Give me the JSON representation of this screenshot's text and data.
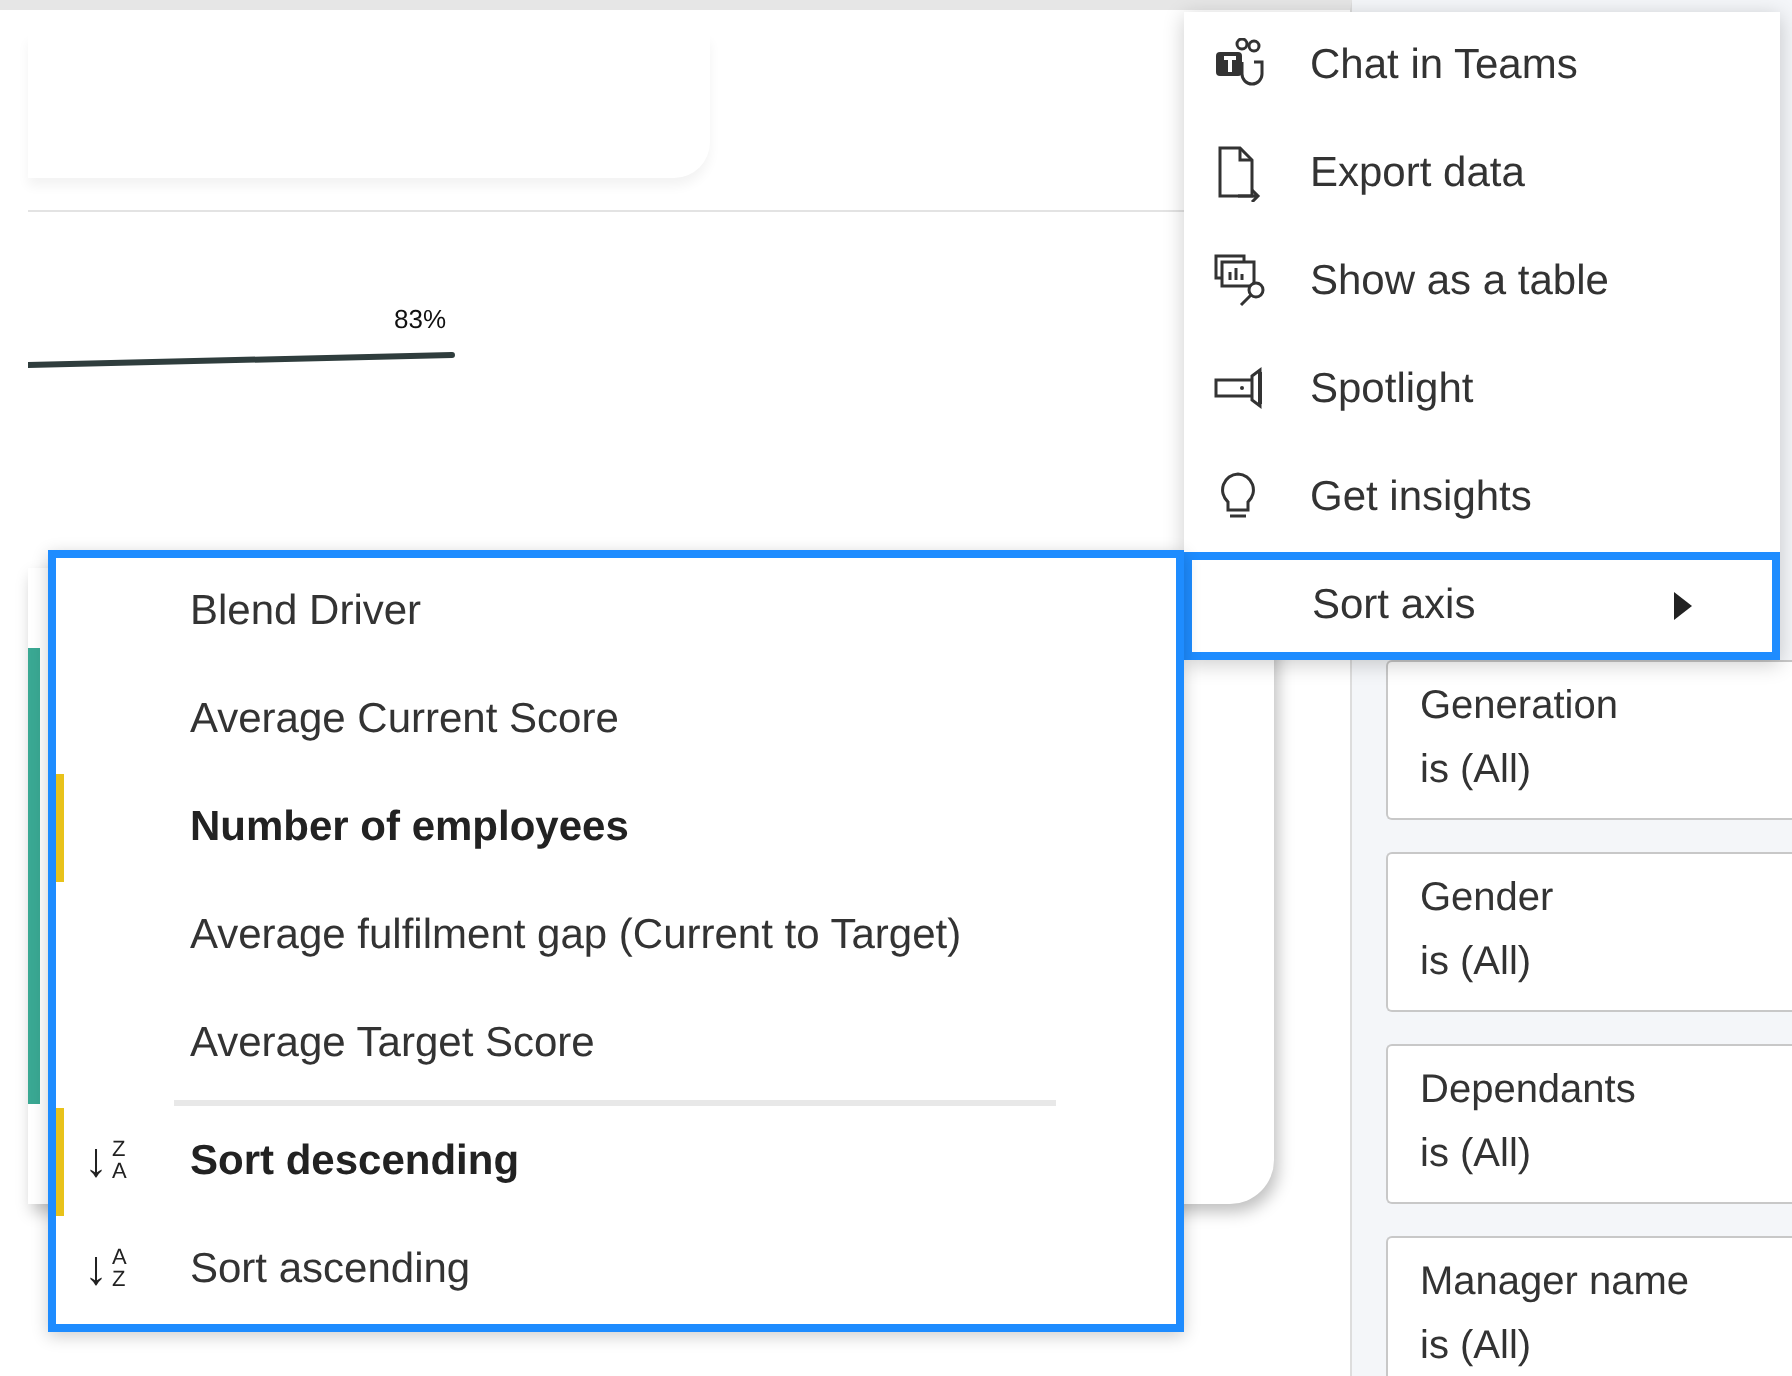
{
  "chart": {
    "data_label": "83%"
  },
  "context_menu": {
    "items": [
      {
        "kind": "teams",
        "label": "Chat in Teams",
        "selected": false
      },
      {
        "kind": "export",
        "label": "Export data",
        "selected": false
      },
      {
        "kind": "table",
        "label": "Show as a table",
        "selected": false
      },
      {
        "kind": "spotlight",
        "label": "Spotlight",
        "selected": false
      },
      {
        "kind": "insights",
        "label": "Get insights",
        "selected": false
      },
      {
        "kind": "submenu",
        "label": "Sort axis",
        "selected": true
      }
    ]
  },
  "sort_menu": {
    "items": [
      {
        "kind": "field",
        "label": "Blend Driver",
        "selected": false
      },
      {
        "kind": "field",
        "label": "Average Current Score",
        "selected": false
      },
      {
        "kind": "field",
        "label": "Number of employees",
        "selected": true
      },
      {
        "kind": "field",
        "label": "Average fulfilment gap (Current to Target)",
        "selected": false
      },
      {
        "kind": "field",
        "label": "Average Target Score",
        "selected": false
      },
      {
        "kind": "separator"
      },
      {
        "kind": "descending",
        "label": "Sort descending",
        "selected": true,
        "icon_text": {
          "arrow": "↓",
          "top": "Z",
          "bottom": "A"
        }
      },
      {
        "kind": "ascending",
        "label": "Sort ascending",
        "selected": false,
        "icon_text": {
          "arrow": "↓",
          "top": "A",
          "bottom": "Z"
        }
      }
    ]
  },
  "filters": [
    {
      "name": "Generation",
      "value": "is (All)"
    },
    {
      "name": "Gender",
      "value": "is (All)"
    },
    {
      "name": "Dependants",
      "value": "is (All)"
    },
    {
      "name": "Manager name",
      "value": "is (All)"
    }
  ]
}
